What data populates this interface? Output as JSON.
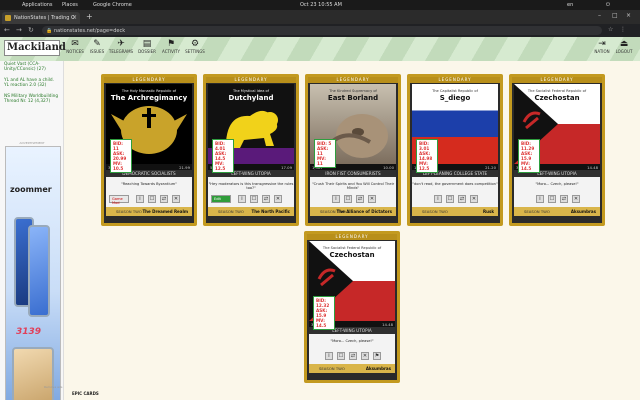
{
  "os": {
    "applications": "Applications",
    "places": "Places",
    "browser_name": "Google Chrome",
    "datetime": "Oct 23  10:55 AM",
    "lang": "en"
  },
  "browser": {
    "tab_title": "NationStates | Trading C",
    "url": "nationstates.net/page=deck"
  },
  "site": {
    "logo": "Mackiland",
    "nav": [
      "NOTICES",
      "ISSUES",
      "TELEGRAMS",
      "DOSSIER",
      "ACTIVITY",
      "SETTINGS"
    ],
    "right_nav": [
      "NATION",
      "LOGOUT"
    ]
  },
  "sidebar": {
    "links": [
      "Quiet Vast (CCA-Unity/CConsic) (27)",
      "YL and AL have a child. YL reaction 2.0 (32)",
      "NS Military Worldbuilding Thread Nr. 12 (4,327)"
    ],
    "ad_label": "ADVERTISEMENT",
    "ad_brand": "zoommer",
    "ad_price": "3139",
    "footer": "Remove ads"
  },
  "cards": [
    {
      "rarity": "LEGENDARY",
      "pretitle": "The Holy Monastic Republic of",
      "title": "The Archregimancy",
      "bid": "BID: 11",
      "ask": "ASK: 20.99",
      "mv": "MV: 10.5",
      "left_meta": "3,847",
      "right_meta": "21.99",
      "category": "DEMOCRATIC SOCIALISTS",
      "motto": "\"Reaching Towards Byzantium\"",
      "game_btn": "Game Mod",
      "season": "SEASON TWO",
      "region": "The Dreamed Realm",
      "accent": "#000000"
    },
    {
      "rarity": "LEGENDARY",
      "pretitle": "The Mystical Idea of",
      "title": "Dutchyland",
      "bid": "BID: 4.01",
      "ask": "ASK: 14.5",
      "mv": "MV: 12.5",
      "left_meta": "5,327",
      "right_meta": "17.09",
      "category": "LEFT-WING UTOPIA",
      "motto": "\"Hey moderators is this transgressive the rules too?\"",
      "game_btn": "Edit",
      "season": "SEASON TWO",
      "region": "The North Pacific",
      "accent": "#5a1a7a"
    },
    {
      "rarity": "LEGENDARY",
      "pretitle": "The Kindred Supremacy of",
      "title": "East Borland",
      "bid": "BID: 5",
      "ask": "ASK: 11",
      "mv": "MV: 11",
      "left_meta": "1,587",
      "right_meta": "10.00",
      "category": "IRON FIST CONSUMERISTS",
      "motto": "\"Crush Their Spirits and You Will Control Their Minds\"",
      "season": "SEASON TWO",
      "region": "The Alliance of Dictators",
      "accent": "#6b5a4a"
    },
    {
      "rarity": "LEGENDARY",
      "pretitle": "The Capitalist Republic of",
      "title": "S_diego",
      "bid": "BID: 3.01",
      "ask": "ASK: 14.98",
      "mv": "MV: 12.5",
      "left_meta": "15,063",
      "right_meta": "21.20",
      "category": "LEFT-LEANING COLLEGE STATE",
      "motto": "\"don't read, the government does competition\"",
      "season": "SEASON TWO",
      "region": "Rusk",
      "accent": "#d52b1e"
    },
    {
      "rarity": "LEGENDARY",
      "pretitle": "The Socialist Federal Republic of",
      "title": "Czechostan",
      "bid": "BID: 11.29",
      "ask": "ASK: 15.9",
      "mv": "MV: 14.5",
      "left_meta": "3,663",
      "right_meta": "14.48",
      "category": "LEFT-WING UTOPIA",
      "motto": "\"Moro... Czech, please!\"",
      "season": "SEASON TWO",
      "region": "Aksumbras",
      "accent": "#c62828"
    },
    {
      "rarity": "LEGENDARY",
      "pretitle": "The Socialist Federal Republic of",
      "title": "Czechostan",
      "bid": "BID: 12.32",
      "ask": "ASK: 15.9",
      "mv": "MV: 14.5",
      "left_meta": "3,663",
      "right_meta": "14.48",
      "category": "LEFT-WING UTOPIA",
      "motto": "\"Moro... Czech, please!\"",
      "season": "SEASON TWO",
      "region": "Aksumbras",
      "accent": "#c62828"
    }
  ],
  "section_label": "EPIC CARDS"
}
